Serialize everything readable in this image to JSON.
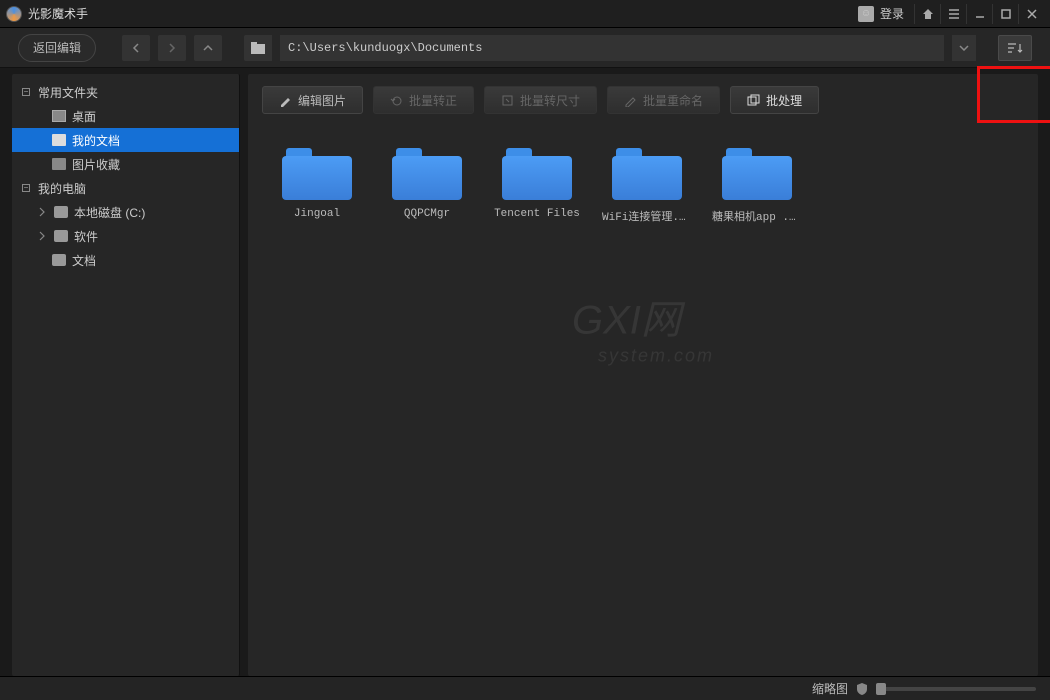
{
  "app": {
    "title": "光影魔术手",
    "login": "登录"
  },
  "nav": {
    "back": "返回编辑",
    "path": "C:\\Users\\kunduogx\\Documents"
  },
  "toolbar": {
    "edit": "编辑图片",
    "rotate": "批量转正",
    "resize": "批量转尺寸",
    "rename": "批量重命名",
    "batch": "批处理"
  },
  "sidebar": {
    "common_folders": "常用文件夹",
    "desktop": "桌面",
    "my_docs": "我的文档",
    "pic_fav": "图片收藏",
    "my_computer": "我的电脑",
    "local_disk": "本地磁盘 (C:)",
    "software": "软件",
    "docs": "文档"
  },
  "folders": [
    {
      "label": "Jingoal"
    },
    {
      "label": "QQPCMgr"
    },
    {
      "label": "Tencent Files"
    },
    {
      "label": "WiFi连接管理..."
    },
    {
      "label": "糖果相机app ..."
    }
  ],
  "statusbar": {
    "thumbnail": "缩略图"
  },
  "watermark": {
    "line1": "GXI网",
    "line2": "system.com"
  }
}
